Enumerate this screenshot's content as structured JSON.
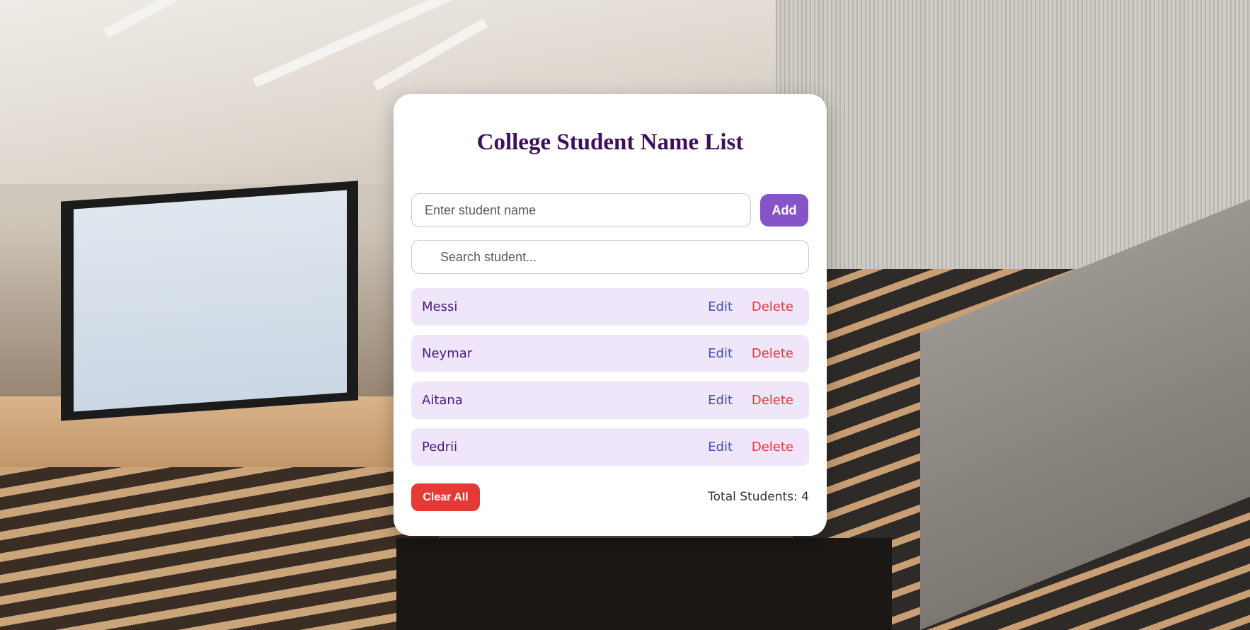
{
  "page": {
    "title": "College Student Name List"
  },
  "form": {
    "name_placeholder": "Enter student name",
    "name_value": "",
    "add_label": "Add"
  },
  "search": {
    "placeholder": "Search student...",
    "value": ""
  },
  "students": [
    {
      "name": "Messi",
      "edit_label": "Edit",
      "delete_label": "Delete"
    },
    {
      "name": "Neymar",
      "edit_label": "Edit",
      "delete_label": "Delete"
    },
    {
      "name": "Aitana",
      "edit_label": "Edit",
      "delete_label": "Delete"
    },
    {
      "name": "Pedrii",
      "edit_label": "Edit",
      "delete_label": "Delete"
    }
  ],
  "footer": {
    "clear_label": "Clear All",
    "total_text": "Total Students: 4"
  },
  "colors": {
    "title": "#3d0f5c",
    "accent": "#8753c8",
    "item_bg": "#f0e6fa",
    "edit": "#3f4fb3",
    "delete": "#e23a3a",
    "clear": "#e53935"
  },
  "background": {
    "icon": "lecture-hall-photo"
  }
}
